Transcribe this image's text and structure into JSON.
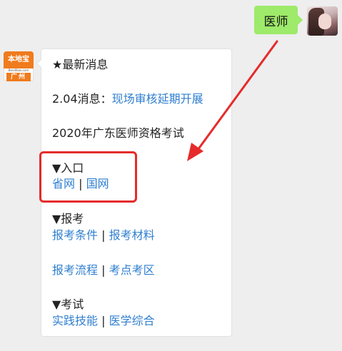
{
  "user_message": {
    "text": "医师"
  },
  "bot_avatar": {
    "brand": "本地宝",
    "domain": "Bendibao.com",
    "city": "广州"
  },
  "bot_message": {
    "news_heading": "★最新消息",
    "news_item": {
      "prefix": "2.04消息：",
      "link": "现场审核延期开展"
    },
    "exam_title": "2020年广东医师资格考试",
    "entry": {
      "heading": "▼入口",
      "links": [
        "省网",
        "国网"
      ]
    },
    "register": {
      "heading": "▼报考",
      "row1": [
        "报考条件",
        "报考材料"
      ],
      "row2": [
        "报考流程",
        "考点考区"
      ]
    },
    "exam": {
      "heading": "▼考试",
      "links": [
        "实践技能",
        "医学综合"
      ]
    },
    "separator": " | "
  },
  "colors": {
    "link": "#2f7fd0",
    "user_bubble": "#9eea6a",
    "highlight": "#e52b2b",
    "brand_orange": "#f07b1d"
  }
}
